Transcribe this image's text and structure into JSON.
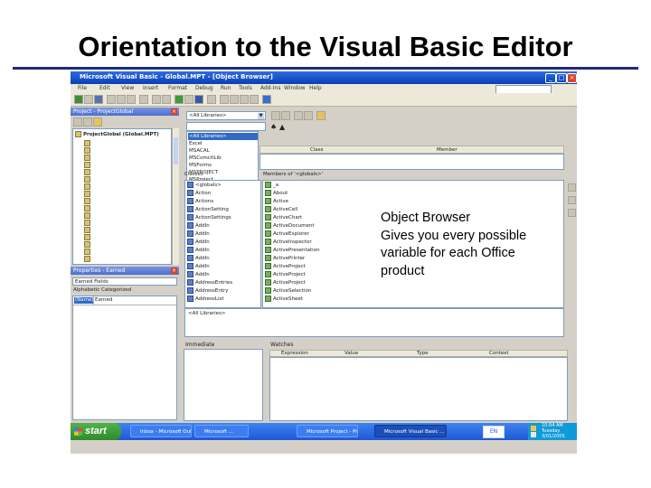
{
  "slide": {
    "title": "Orientation to the Visual Basic Editor",
    "callout_lines": [
      "Object Browser",
      "Gives you every possible",
      "variable for each Office",
      "product"
    ]
  },
  "window": {
    "title": "Microsoft Visual Basic - Global.MPT - [Object Browser]",
    "menu": [
      "File",
      "Edit",
      "View",
      "Insert",
      "Format",
      "Debug",
      "Run",
      "Tools",
      "Add-Ins",
      "Window",
      "Help"
    ]
  },
  "project": {
    "title": "Project - ProjectGlobal",
    "root": "ProjectGlobal (Global.MPT)"
  },
  "properties": {
    "title": "Properties - Earned",
    "object": "Earned Fields",
    "tabs": [
      "Alphabetic",
      "Categorized"
    ],
    "row_name": "(Name)",
    "row_value": "Earned"
  },
  "browser": {
    "library_combo": "<All Libraries>",
    "libraries": [
      "<All Libraries>",
      "Excel",
      "MSACAL",
      "MSComctlLib",
      "MSForms",
      "MSPROJECT",
      "MSProject",
      "Office"
    ],
    "col_class": "Class",
    "col_member": "Member",
    "classes_header": "Classes",
    "members_header": "Members of '<globals>'",
    "classes": [
      "<globals>",
      "Action",
      "Actions",
      "ActionSetting",
      "ActionSettings",
      "AddIn",
      "AddIn",
      "AddIn",
      "AddIn",
      "AddIn",
      "AddIn",
      "AddIn",
      "AddressEntries",
      "AddressEntry",
      "AddressList"
    ],
    "members": [
      "_a",
      "About",
      "Active",
      "ActiveCell",
      "ActiveChart",
      "ActiveDocument",
      "ActiveExplorer",
      "ActiveInspector",
      "ActivePresentation",
      "ActivePrinter",
      "ActiveProject",
      "ActiveProject",
      "ActiveProject",
      "ActiveSelection",
      "ActiveSheet"
    ],
    "detail": "<All Libraries>"
  },
  "immediate": {
    "title": "Immediate"
  },
  "watches": {
    "title": "Watches",
    "columns": [
      "Expression",
      "Value",
      "Type",
      "Context"
    ]
  },
  "taskbar": {
    "start": "start",
    "items": [
      "Inbox - Microsoft Out...",
      "Microsoft ...",
      "Microsoft Project - Pr...",
      "Microsoft Visual Basic ..."
    ],
    "lang": "EN",
    "clock_lines": [
      "10:04 AM",
      "Tuesday",
      "3/01/2005"
    ]
  },
  "colors": {
    "title_rule": "#1f2a7a",
    "title_bar": "#0a3fb6",
    "taskbar": "#1f58d6",
    "start": "#2f8a2d",
    "selection": "#316ac5"
  }
}
